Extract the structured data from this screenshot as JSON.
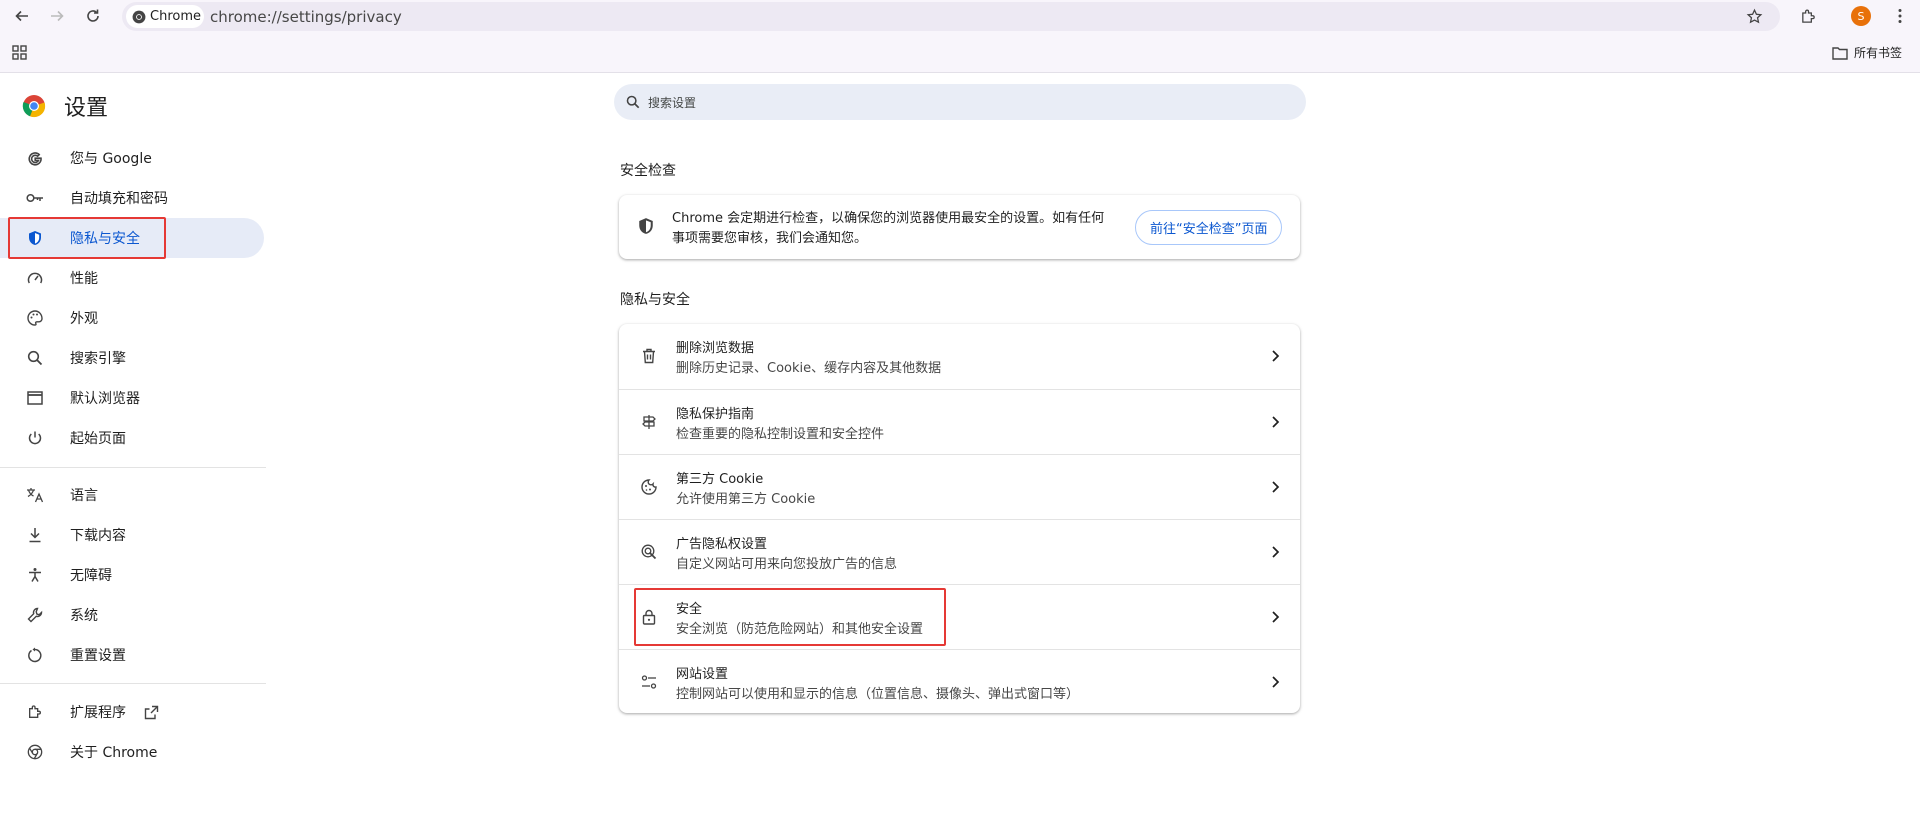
{
  "browser": {
    "chip_label": "Chrome",
    "url": "chrome://settings/privacy",
    "avatar_letter": "S",
    "bookmarks_label": "所有书签"
  },
  "header": {
    "title": "设置"
  },
  "search": {
    "placeholder": "搜索设置"
  },
  "sidebar": {
    "items": [
      {
        "label": "您与 Google",
        "icon": "google-icon"
      },
      {
        "label": "自动填充和密码",
        "icon": "key-icon"
      },
      {
        "label": "隐私与安全",
        "icon": "shield-icon",
        "active": true
      },
      {
        "label": "性能",
        "icon": "speedometer-icon"
      },
      {
        "label": "外观",
        "icon": "palette-icon"
      },
      {
        "label": "搜索引擎",
        "icon": "search-icon"
      },
      {
        "label": "默认浏览器",
        "icon": "browser-window-icon"
      },
      {
        "label": "起始页面",
        "icon": "power-icon"
      },
      {
        "label": "语言",
        "icon": "translate-icon"
      },
      {
        "label": "下载内容",
        "icon": "download-icon"
      },
      {
        "label": "无障碍",
        "icon": "accessibility-icon"
      },
      {
        "label": "系统",
        "icon": "wrench-icon"
      },
      {
        "label": "重置设置",
        "icon": "reset-icon"
      },
      {
        "label": "扩展程序",
        "icon": "extension-icon"
      },
      {
        "label": "关于 Chrome",
        "icon": "chrome-icon"
      }
    ]
  },
  "safety_check": {
    "title": "安全检查",
    "description": "Chrome 会定期进行检查，以确保您的浏览器使用最安全的设置。如有任何事项需要您审核，我们会通知您。",
    "button_label": "前往“安全检查”页面"
  },
  "privacy": {
    "title": "隐私与安全",
    "rows": [
      {
        "title": "删除浏览数据",
        "subtitle": "删除历史记录、Cookie、缓存内容及其他数据",
        "icon": "trash-icon"
      },
      {
        "title": "隐私保护指南",
        "subtitle": "检查重要的隐私控制设置和安全控件",
        "icon": "guide-icon"
      },
      {
        "title": "第三方 Cookie",
        "subtitle": "允许使用第三方 Cookie",
        "icon": "cookie-icon"
      },
      {
        "title": "广告隐私权设置",
        "subtitle": "自定义网站可用来向您投放广告的信息",
        "icon": "ad-privacy-icon"
      },
      {
        "title": "安全",
        "subtitle": "安全浏览（防范危险网站）和其他安全设置",
        "icon": "lock-icon"
      },
      {
        "title": "网站设置",
        "subtitle": "控制网站可以使用和显示的信息（位置信息、摄像头、弹出式窗口等）",
        "icon": "tune-icon"
      }
    ]
  },
  "colors": {
    "accent": "#0b57d0",
    "highlight": "#e53935",
    "active_bg": "#e6ebf7"
  }
}
